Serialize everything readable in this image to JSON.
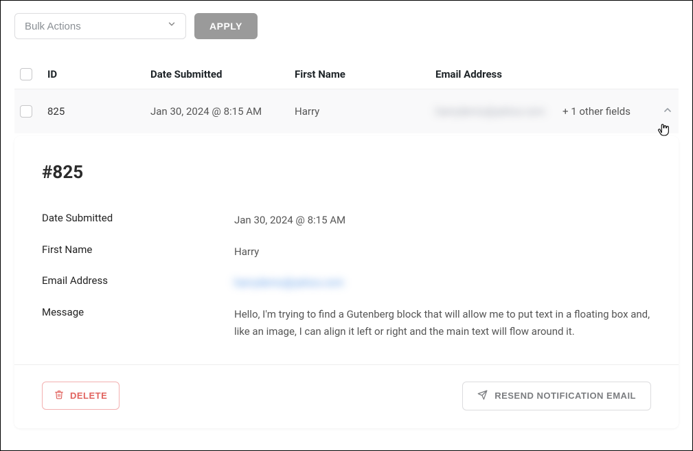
{
  "toolbar": {
    "bulk_placeholder": "Bulk Actions",
    "apply_label": "APPLY"
  },
  "table": {
    "headers": {
      "id": "ID",
      "date": "Date Submitted",
      "fname": "First Name",
      "email": "Email Address"
    },
    "row": {
      "id": "825",
      "date": "Jan 30, 2024 @ 8:15 AM",
      "fname": "Harry",
      "email_masked": "harrydemo@yahoo.com",
      "extra": "+ 1 other fields"
    }
  },
  "detail": {
    "title": "#825",
    "labels": {
      "date": "Date Submitted",
      "fname": "First Name",
      "email": "Email Address",
      "message": "Message"
    },
    "values": {
      "date": "Jan 30, 2024 @ 8:15 AM",
      "fname": "Harry",
      "email_masked": "harrydemo@yahoo.com",
      "message": "Hello, I'm trying to find a Gutenberg block that will allow me to put text in a floating box and, like an image, I can align it left or right and the main text will flow around it."
    }
  },
  "actions": {
    "delete": "DELETE",
    "resend": "RESEND NOTIFICATION EMAIL"
  }
}
